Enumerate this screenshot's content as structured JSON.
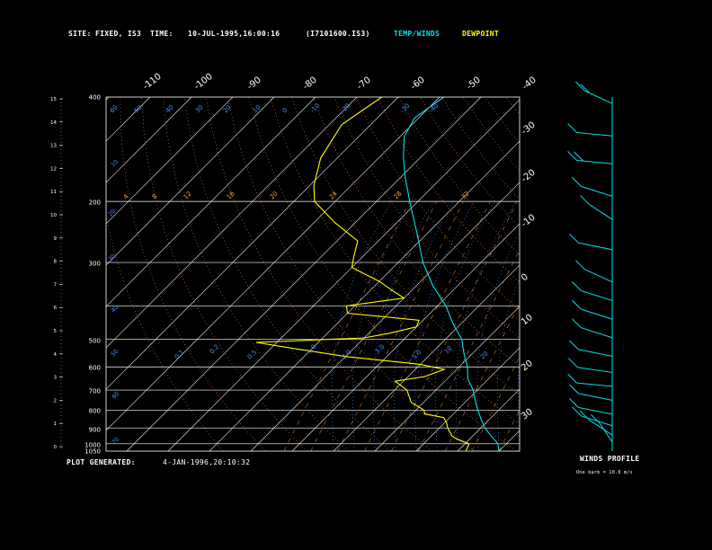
{
  "header": {
    "site_label": "SITE:",
    "site_value": "FIXED, IS3",
    "time_label": "TIME:",
    "time_value": "10-JUL-1995,16:00:16",
    "file_id": "(I7101600.IS3)",
    "legend_temp": "TEMP/WINDS",
    "legend_dew": "DEWPOINT"
  },
  "footer": {
    "plot_generated_label": "PLOT GENERATED:",
    "plot_generated_value": "4-JAN-1996,20:10:32",
    "winds_profile_title": "WINDS PROFILE",
    "winds_profile_note": "One barb = 10.0 m/s"
  },
  "colors": {
    "temp": "#00e0e8",
    "dew": "#ffff00",
    "isotherm": "#ffffff",
    "isobar": "#ffffff",
    "dry_adiabat": "#ff8040",
    "mixing_ratio": "#ffa040",
    "moist_adiabat": "#5090ff",
    "axis_text": "#ffffff"
  },
  "chart_data": {
    "type": "skew-t log-p",
    "pressure_levels": [
      400,
      300,
      200,
      1000,
      500,
      600,
      700,
      800,
      900,
      1050
    ],
    "pressure_label_text": [
      "400",
      "300",
      "200",
      "1000",
      "500",
      "600",
      "700",
      "800",
      "900",
      "1050"
    ],
    "isotherm_top_labels": [
      "-110",
      "-100",
      "-90",
      "-80",
      "-70",
      "-60",
      "-50",
      "-40"
    ],
    "isotherm_right_labels": [
      "-30",
      "-20",
      "-10",
      "0",
      "10",
      "20",
      "30"
    ],
    "height_km_labels": [
      "0",
      "1",
      "2",
      "3",
      "4",
      "5",
      "6",
      "7",
      "8",
      "9",
      "10",
      "11",
      "12",
      "13",
      "14",
      "15"
    ],
    "mixing_ratio_labels": [
      "4",
      "8",
      "12",
      "16",
      "20",
      "24",
      "28",
      "32"
    ],
    "dry_adiabat_labels": [
      "60",
      "50",
      "40",
      "30",
      "20",
      "10",
      "0",
      "-10",
      "-20",
      "-30",
      "-40"
    ],
    "moist_adiabat_labels": [
      "0.1",
      "0.2",
      "0.5",
      "1.0",
      "2.0",
      "3.0",
      "5.0",
      "10",
      "20"
    ],
    "temperature_profile": [
      {
        "p": 1050,
        "t": 30.0
      },
      {
        "p": 1000,
        "t": 28.0
      },
      {
        "p": 950,
        "t": 24.5
      },
      {
        "p": 900,
        "t": 21.0
      },
      {
        "p": 850,
        "t": 18.0
      },
      {
        "p": 800,
        "t": 15.0
      },
      {
        "p": 750,
        "t": 12.0
      },
      {
        "p": 700,
        "t": 9.0
      },
      {
        "p": 650,
        "t": 5.0
      },
      {
        "p": 600,
        "t": 2.0
      },
      {
        "p": 550,
        "t": -2.0
      },
      {
        "p": 500,
        "t": -6.0
      },
      {
        "p": 450,
        "t": -12.0
      },
      {
        "p": 400,
        "t": -18.0
      },
      {
        "p": 350,
        "t": -26.0
      },
      {
        "p": 300,
        "t": -34.0
      },
      {
        "p": 250,
        "t": -42.0
      },
      {
        "p": 200,
        "t": -52.0
      },
      {
        "p": 170,
        "t": -59.0
      },
      {
        "p": 150,
        "t": -64.0
      },
      {
        "p": 130,
        "t": -69.0
      },
      {
        "p": 115,
        "t": -71.0
      },
      {
        "p": 100,
        "t": -69.0
      }
    ],
    "dewpoint_profile": [
      {
        "p": 1050,
        "t": 22.0
      },
      {
        "p": 1000,
        "t": 21.0
      },
      {
        "p": 970,
        "t": 17.0
      },
      {
        "p": 950,
        "t": 15.0
      },
      {
        "p": 900,
        "t": 12.0
      },
      {
        "p": 870,
        "t": 10.5
      },
      {
        "p": 840,
        "t": 8.5
      },
      {
        "p": 820,
        "t": 3.0
      },
      {
        "p": 800,
        "t": 2.0
      },
      {
        "p": 760,
        "t": -3.0
      },
      {
        "p": 700,
        "t": -7.0
      },
      {
        "p": 660,
        "t": -12.0
      },
      {
        "p": 640,
        "t": -6.0
      },
      {
        "p": 610,
        "t": -3.0
      },
      {
        "p": 590,
        "t": -10.0
      },
      {
        "p": 560,
        "t": -30.0
      },
      {
        "p": 530,
        "t": -45.0
      },
      {
        "p": 510,
        "t": -55.0
      },
      {
        "p": 495,
        "t": -30.0
      },
      {
        "p": 480,
        "t": -25.0
      },
      {
        "p": 460,
        "t": -20.0
      },
      {
        "p": 440,
        "t": -21.0
      },
      {
        "p": 420,
        "t": -40.0
      },
      {
        "p": 400,
        "t": -42.0
      },
      {
        "p": 380,
        "t": -30.0
      },
      {
        "p": 360,
        "t": -35.0
      },
      {
        "p": 340,
        "t": -40.0
      },
      {
        "p": 310,
        "t": -50.0
      },
      {
        "p": 290,
        "t": -52.0
      },
      {
        "p": 260,
        "t": -55.0
      },
      {
        "p": 230,
        "t": -65.0
      },
      {
        "p": 200,
        "t": -75.0
      },
      {
        "p": 180,
        "t": -79.0
      },
      {
        "p": 150,
        "t": -84.0
      },
      {
        "p": 120,
        "t": -87.0
      },
      {
        "p": 100,
        "t": -84.0
      }
    ],
    "wind_profile_mps": [
      {
        "km": 0.2,
        "dir": 200,
        "spd": 5
      },
      {
        "km": 0.5,
        "dir": 220,
        "spd": 8
      },
      {
        "km": 0.9,
        "dir": 240,
        "spd": 10
      },
      {
        "km": 1.4,
        "dir": 250,
        "spd": 12
      },
      {
        "km": 2.0,
        "dir": 250,
        "spd": 12
      },
      {
        "km": 2.6,
        "dir": 260,
        "spd": 14
      },
      {
        "km": 3.2,
        "dir": 255,
        "spd": 12
      },
      {
        "km": 3.9,
        "dir": 250,
        "spd": 12
      },
      {
        "km": 4.7,
        "dir": 240,
        "spd": 12
      },
      {
        "km": 5.5,
        "dir": 240,
        "spd": 10
      },
      {
        "km": 6.3,
        "dir": 240,
        "spd": 10
      },
      {
        "km": 7.1,
        "dir": 230,
        "spd": 8
      },
      {
        "km": 8.5,
        "dir": 250,
        "spd": 10
      },
      {
        "km": 9.8,
        "dir": 320,
        "spd": 10
      },
      {
        "km": 10.8,
        "dir": 300,
        "spd": 8
      },
      {
        "km": 12.2,
        "dir": 260,
        "spd": 20
      },
      {
        "km": 13.4,
        "dir": 280,
        "spd": 12
      },
      {
        "km": 14.8,
        "dir": 310,
        "spd": 15
      }
    ]
  }
}
